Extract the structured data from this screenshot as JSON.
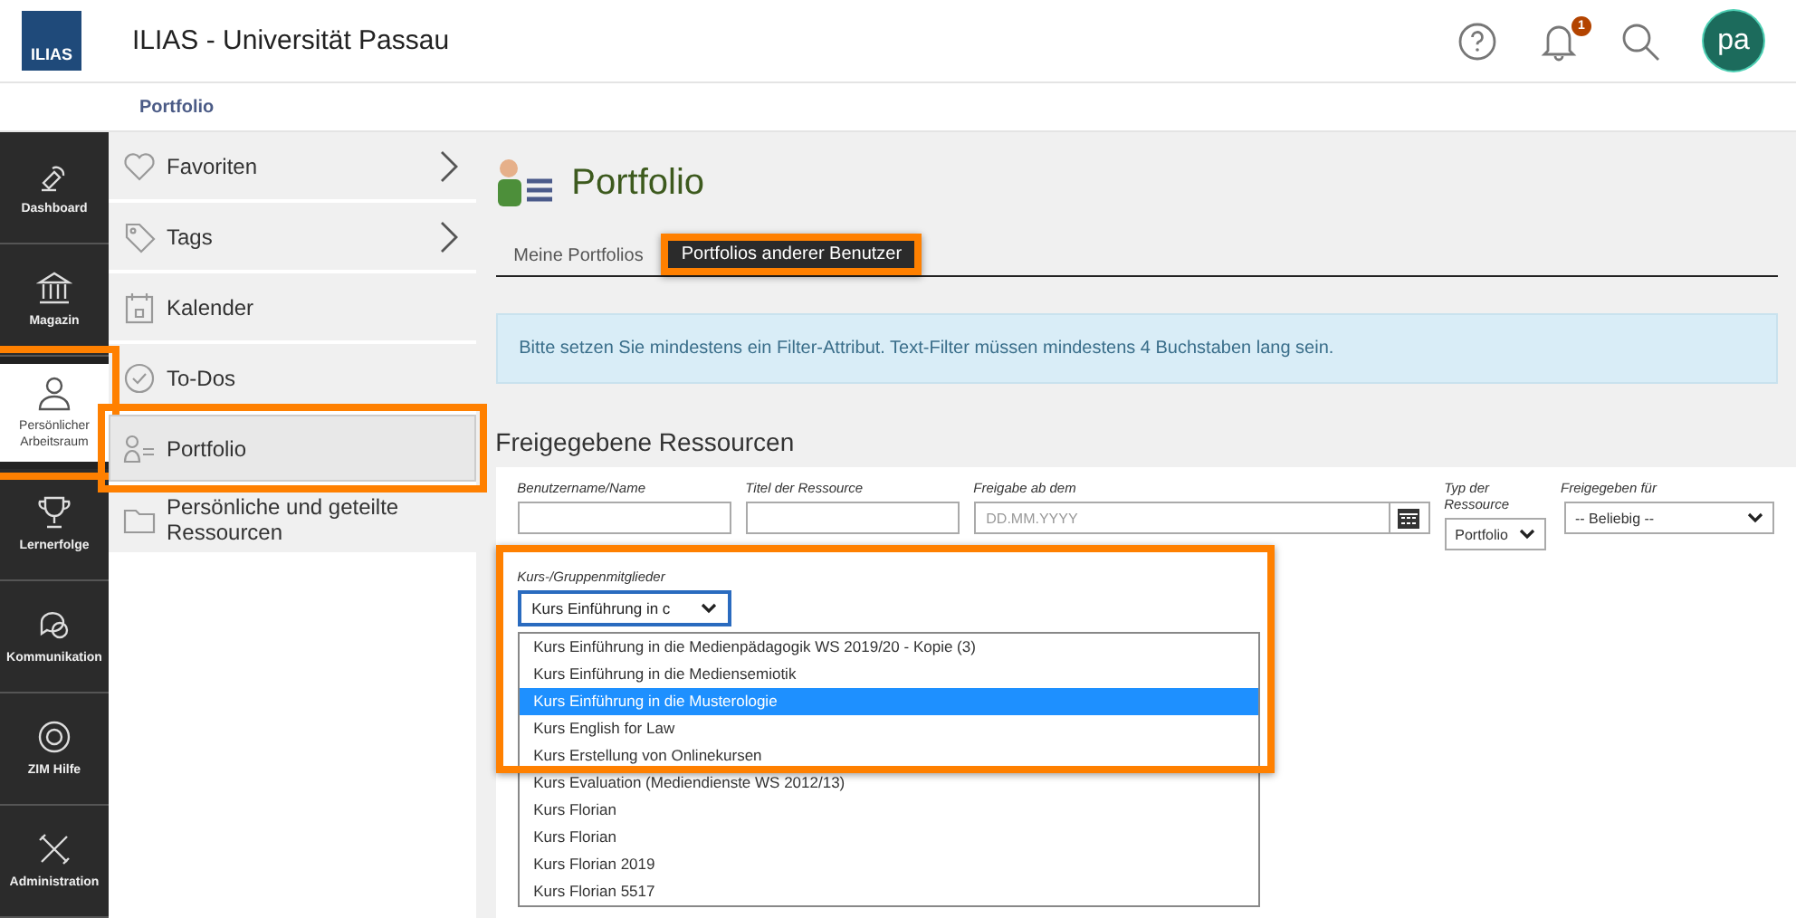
{
  "header": {
    "logo": "ILIAS",
    "title": "ILIAS - Universität Passau",
    "notification_count": "1",
    "avatar": "pa"
  },
  "breadcrumb": "Portfolio",
  "mainbar": [
    {
      "label": "Dashboard",
      "selected": false,
      "highlighted": false
    },
    {
      "label": "Magazin",
      "selected": false,
      "highlighted": false
    },
    {
      "label": "Persönlicher Arbeitsraum",
      "selected": true,
      "highlighted": true
    },
    {
      "label": "Lernerfolge",
      "selected": false,
      "highlighted": false
    },
    {
      "label": "Kommunikation",
      "selected": false,
      "highlighted": false
    },
    {
      "label": "ZIM Hilfe",
      "selected": false,
      "highlighted": false
    },
    {
      "label": "Administration",
      "selected": false,
      "highlighted": false
    }
  ],
  "slate": [
    {
      "label": "Favoriten",
      "has_submenu": true,
      "selected": false,
      "highlighted": false
    },
    {
      "label": "Tags",
      "has_submenu": true,
      "selected": false,
      "highlighted": false
    },
    {
      "label": "Kalender",
      "has_submenu": false,
      "selected": false,
      "highlighted": false
    },
    {
      "label": "To-Dos",
      "has_submenu": false,
      "selected": false,
      "highlighted": false
    },
    {
      "label": "Portfolio",
      "has_submenu": false,
      "selected": true,
      "highlighted": true
    },
    {
      "label": "Persönliche und geteilte Ressourcen",
      "has_submenu": false,
      "selected": false,
      "highlighted": false
    }
  ],
  "page_title": "Portfolio",
  "tabs": [
    {
      "label": "Meine Portfolios",
      "selected": false,
      "highlighted": false
    },
    {
      "label": "Portfolios anderer Benutzer",
      "selected": true,
      "highlighted": true
    }
  ],
  "alert": "Bitte setzen Sie mindestens ein Filter-Attribut. Text-Filter müssen mindestens 4 Buchstaben lang sein.",
  "section_title": "Freigegebene Ressourcen",
  "filters": [
    {
      "label": "Benutzername/Name",
      "kind": "text"
    },
    {
      "label": "Titel der Ressource",
      "kind": "text"
    },
    {
      "label": "Freigabe ab dem",
      "kind": "date",
      "placeholder": "DD.MM.YYYY"
    },
    {
      "label": "Typ der Ressource",
      "kind": "select",
      "value": "Portfolio"
    },
    {
      "label": "Freigegeben für",
      "kind": "select",
      "value": "-- Beliebig --"
    }
  ],
  "course_filter": {
    "label": "Kurs-/Gruppenmitglieder",
    "value": "Kurs Einführung in c",
    "highlighted": true,
    "options": [
      {
        "label": "Kurs Einführung in die Medienpädagogik WS 2019/20 - Kopie (3)",
        "selected": false
      },
      {
        "label": "Kurs Einführung in die Mediensemiotik",
        "selected": false
      },
      {
        "label": "Kurs Einführung in die Musterologie",
        "selected": true
      },
      {
        "label": "Kurs English for Law",
        "selected": false
      },
      {
        "label": "Kurs Erstellung von Onlinekursen",
        "selected": false
      },
      {
        "label": "Kurs Evaluation (Mediendienste WS 2012/13)",
        "selected": false
      },
      {
        "label": "Kurs Florian",
        "selected": false
      },
      {
        "label": "Kurs Florian",
        "selected": false
      },
      {
        "label": "Kurs Florian 2019",
        "selected": false
      },
      {
        "label": "Kurs Florian 5517",
        "selected": false
      }
    ]
  }
}
